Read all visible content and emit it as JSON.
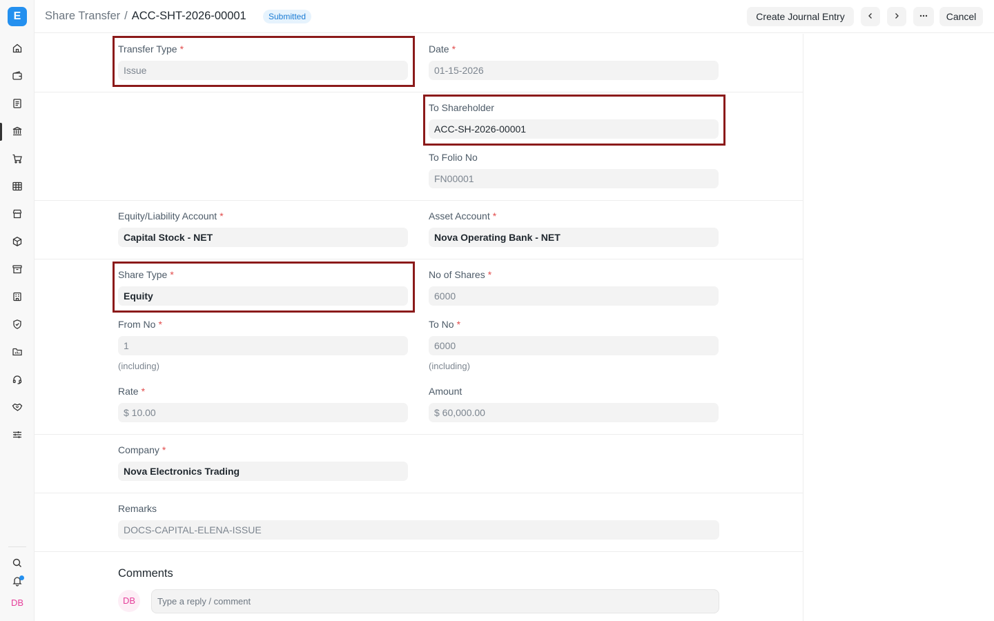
{
  "sidebar": {
    "logo": "E",
    "user_initials": "DB",
    "icons": [
      "home-icon",
      "wallet-icon",
      "document-icon",
      "bank-icon",
      "cart-icon",
      "table-icon",
      "store-icon",
      "package-icon",
      "archive-icon",
      "building-icon",
      "shield-icon",
      "folder-icon",
      "headset-icon",
      "handshake-icon",
      "settings-sliders-icon"
    ],
    "bottom_icons": [
      "search-icon",
      "bell-icon"
    ]
  },
  "header": {
    "breadcrumb_parent": "Share Transfer",
    "separator": "/",
    "doc_name": "ACC-SHT-2026-00001",
    "status": "Submitted",
    "create_journal_entry": "Create Journal Entry",
    "cancel": "Cancel"
  },
  "form": {
    "transfer_type": {
      "label": "Transfer Type",
      "value": "Issue"
    },
    "date": {
      "label": "Date",
      "value": "01-15-2026"
    },
    "to_shareholder": {
      "label": "To Shareholder",
      "value": "ACC-SH-2026-00001"
    },
    "to_folio_no": {
      "label": "To Folio No",
      "value": "FN00001"
    },
    "equity_account": {
      "label": "Equity/Liability Account",
      "value": "Capital Stock - NET"
    },
    "asset_account": {
      "label": "Asset Account",
      "value": "Nova Operating Bank - NET"
    },
    "share_type": {
      "label": "Share Type",
      "value": "Equity"
    },
    "no_of_shares": {
      "label": "No of Shares",
      "value": "6000"
    },
    "from_no": {
      "label": "From No",
      "value": "1",
      "help": "(including)"
    },
    "to_no": {
      "label": "To No",
      "value": "6000",
      "help": "(including)"
    },
    "rate": {
      "label": "Rate",
      "value": "$ 10.00"
    },
    "amount": {
      "label": "Amount",
      "value": "$ 60,000.00"
    },
    "company": {
      "label": "Company",
      "value": "Nova Electronics Trading"
    },
    "remarks": {
      "label": "Remarks",
      "value": "DOCS-CAPITAL-ELENA-ISSUE"
    },
    "required_mark": "*"
  },
  "comments": {
    "title": "Comments",
    "avatar": "DB",
    "placeholder": "Type a reply / comment"
  },
  "colors": {
    "accent": "#2490ef",
    "highlight_box": "#8b1a1a",
    "required": "#e24c4c"
  }
}
